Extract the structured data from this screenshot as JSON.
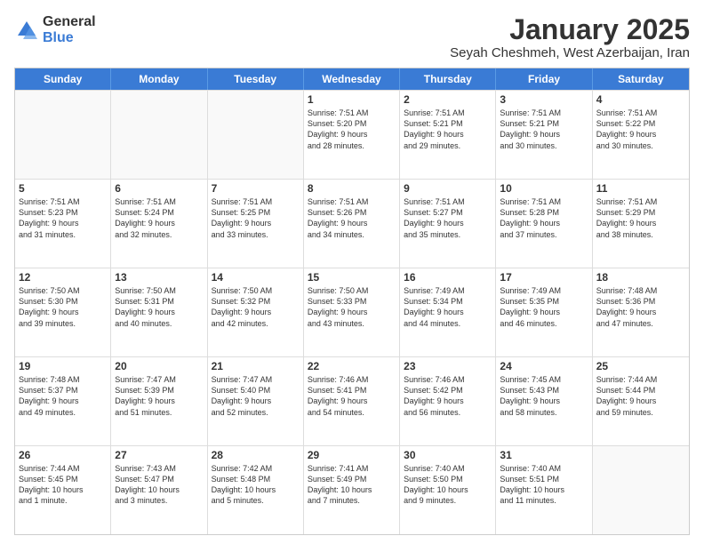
{
  "logo": {
    "general": "General",
    "blue": "Blue"
  },
  "header": {
    "month": "January 2025",
    "location": "Seyah Cheshmeh, West Azerbaijan, Iran"
  },
  "weekdays": [
    "Sunday",
    "Monday",
    "Tuesday",
    "Wednesday",
    "Thursday",
    "Friday",
    "Saturday"
  ],
  "rows": [
    [
      {
        "day": "",
        "info": ""
      },
      {
        "day": "",
        "info": ""
      },
      {
        "day": "",
        "info": ""
      },
      {
        "day": "1",
        "info": "Sunrise: 7:51 AM\nSunset: 5:20 PM\nDaylight: 9 hours\nand 28 minutes."
      },
      {
        "day": "2",
        "info": "Sunrise: 7:51 AM\nSunset: 5:21 PM\nDaylight: 9 hours\nand 29 minutes."
      },
      {
        "day": "3",
        "info": "Sunrise: 7:51 AM\nSunset: 5:21 PM\nDaylight: 9 hours\nand 30 minutes."
      },
      {
        "day": "4",
        "info": "Sunrise: 7:51 AM\nSunset: 5:22 PM\nDaylight: 9 hours\nand 30 minutes."
      }
    ],
    [
      {
        "day": "5",
        "info": "Sunrise: 7:51 AM\nSunset: 5:23 PM\nDaylight: 9 hours\nand 31 minutes."
      },
      {
        "day": "6",
        "info": "Sunrise: 7:51 AM\nSunset: 5:24 PM\nDaylight: 9 hours\nand 32 minutes."
      },
      {
        "day": "7",
        "info": "Sunrise: 7:51 AM\nSunset: 5:25 PM\nDaylight: 9 hours\nand 33 minutes."
      },
      {
        "day": "8",
        "info": "Sunrise: 7:51 AM\nSunset: 5:26 PM\nDaylight: 9 hours\nand 34 minutes."
      },
      {
        "day": "9",
        "info": "Sunrise: 7:51 AM\nSunset: 5:27 PM\nDaylight: 9 hours\nand 35 minutes."
      },
      {
        "day": "10",
        "info": "Sunrise: 7:51 AM\nSunset: 5:28 PM\nDaylight: 9 hours\nand 37 minutes."
      },
      {
        "day": "11",
        "info": "Sunrise: 7:51 AM\nSunset: 5:29 PM\nDaylight: 9 hours\nand 38 minutes."
      }
    ],
    [
      {
        "day": "12",
        "info": "Sunrise: 7:50 AM\nSunset: 5:30 PM\nDaylight: 9 hours\nand 39 minutes."
      },
      {
        "day": "13",
        "info": "Sunrise: 7:50 AM\nSunset: 5:31 PM\nDaylight: 9 hours\nand 40 minutes."
      },
      {
        "day": "14",
        "info": "Sunrise: 7:50 AM\nSunset: 5:32 PM\nDaylight: 9 hours\nand 42 minutes."
      },
      {
        "day": "15",
        "info": "Sunrise: 7:50 AM\nSunset: 5:33 PM\nDaylight: 9 hours\nand 43 minutes."
      },
      {
        "day": "16",
        "info": "Sunrise: 7:49 AM\nSunset: 5:34 PM\nDaylight: 9 hours\nand 44 minutes."
      },
      {
        "day": "17",
        "info": "Sunrise: 7:49 AM\nSunset: 5:35 PM\nDaylight: 9 hours\nand 46 minutes."
      },
      {
        "day": "18",
        "info": "Sunrise: 7:48 AM\nSunset: 5:36 PM\nDaylight: 9 hours\nand 47 minutes."
      }
    ],
    [
      {
        "day": "19",
        "info": "Sunrise: 7:48 AM\nSunset: 5:37 PM\nDaylight: 9 hours\nand 49 minutes."
      },
      {
        "day": "20",
        "info": "Sunrise: 7:47 AM\nSunset: 5:39 PM\nDaylight: 9 hours\nand 51 minutes."
      },
      {
        "day": "21",
        "info": "Sunrise: 7:47 AM\nSunset: 5:40 PM\nDaylight: 9 hours\nand 52 minutes."
      },
      {
        "day": "22",
        "info": "Sunrise: 7:46 AM\nSunset: 5:41 PM\nDaylight: 9 hours\nand 54 minutes."
      },
      {
        "day": "23",
        "info": "Sunrise: 7:46 AM\nSunset: 5:42 PM\nDaylight: 9 hours\nand 56 minutes."
      },
      {
        "day": "24",
        "info": "Sunrise: 7:45 AM\nSunset: 5:43 PM\nDaylight: 9 hours\nand 58 minutes."
      },
      {
        "day": "25",
        "info": "Sunrise: 7:44 AM\nSunset: 5:44 PM\nDaylight: 9 hours\nand 59 minutes."
      }
    ],
    [
      {
        "day": "26",
        "info": "Sunrise: 7:44 AM\nSunset: 5:45 PM\nDaylight: 10 hours\nand 1 minute."
      },
      {
        "day": "27",
        "info": "Sunrise: 7:43 AM\nSunset: 5:47 PM\nDaylight: 10 hours\nand 3 minutes."
      },
      {
        "day": "28",
        "info": "Sunrise: 7:42 AM\nSunset: 5:48 PM\nDaylight: 10 hours\nand 5 minutes."
      },
      {
        "day": "29",
        "info": "Sunrise: 7:41 AM\nSunset: 5:49 PM\nDaylight: 10 hours\nand 7 minutes."
      },
      {
        "day": "30",
        "info": "Sunrise: 7:40 AM\nSunset: 5:50 PM\nDaylight: 10 hours\nand 9 minutes."
      },
      {
        "day": "31",
        "info": "Sunrise: 7:40 AM\nSunset: 5:51 PM\nDaylight: 10 hours\nand 11 minutes."
      },
      {
        "day": "",
        "info": ""
      }
    ]
  ]
}
